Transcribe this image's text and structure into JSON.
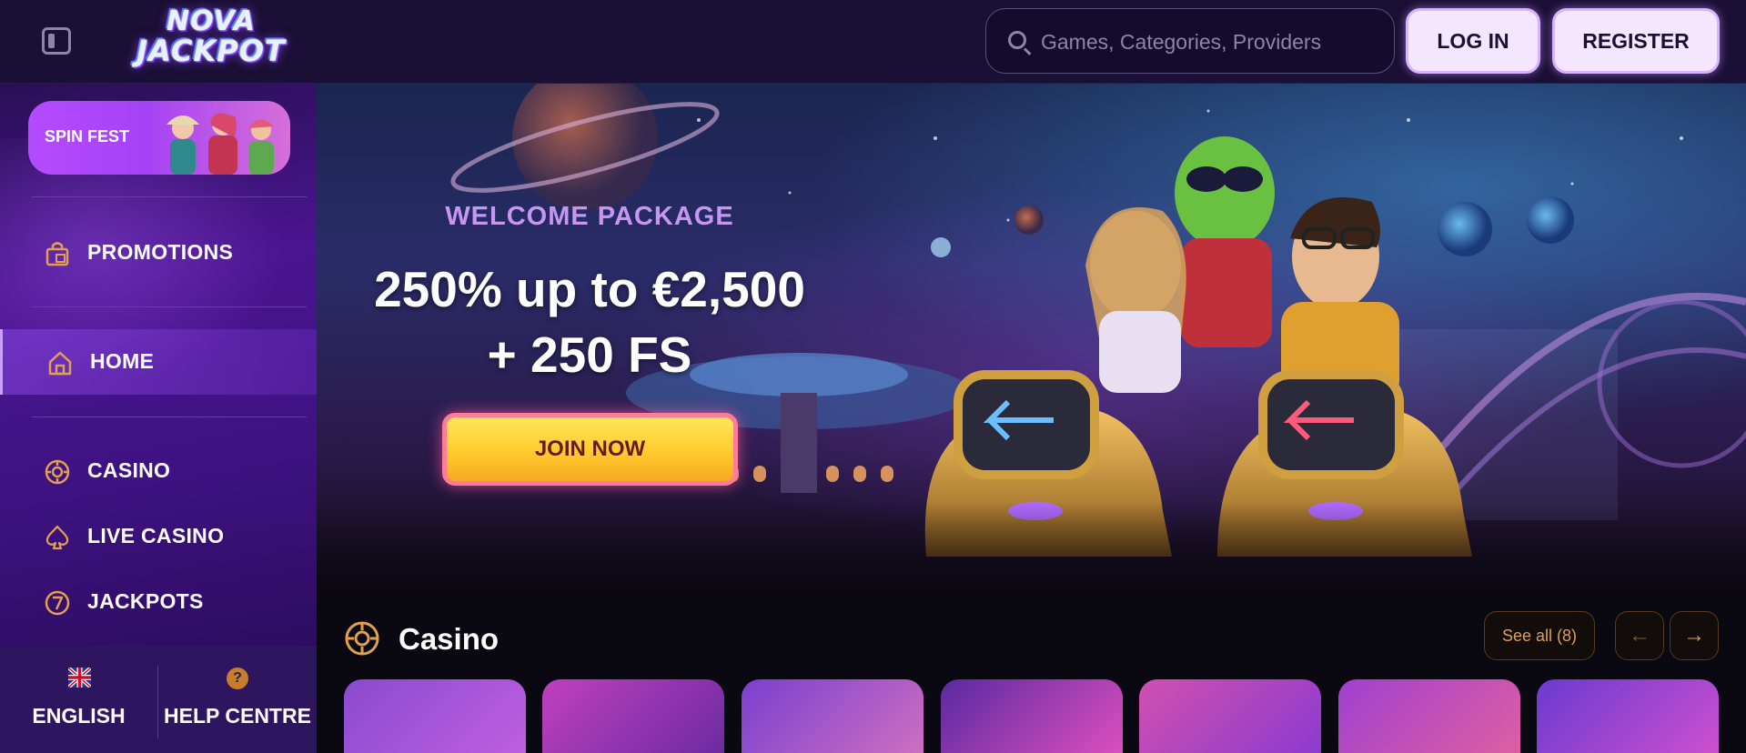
{
  "header": {
    "logo_line1": "NOVA",
    "logo_line2": "JACKPOT",
    "search_placeholder": "Games, Categories, Providers",
    "login_label": "LOG IN",
    "register_label": "REGISTER"
  },
  "sidebar": {
    "promo_banner": {
      "label": "SPIN FEST"
    },
    "items": [
      {
        "label": "PROMOTIONS",
        "icon": "gift-bag-icon",
        "active": false
      },
      {
        "label": "HOME",
        "icon": "home-icon",
        "active": true
      },
      {
        "label": "CASINO",
        "icon": "chip-icon",
        "active": false
      },
      {
        "label": "LIVE CASINO",
        "icon": "spade-icon",
        "active": false
      },
      {
        "label": "JACKPOTS",
        "icon": "seven-icon",
        "active": false
      }
    ],
    "footer": {
      "language_label": "ENGLISH",
      "language_icon": "uk-flag-icon",
      "help_label": "HELP CENTRE",
      "help_icon": "question-icon"
    }
  },
  "hero": {
    "eyebrow": "WELCOME PACKAGE",
    "title_line1": "250% up to €2,500",
    "title_line2": "+ 250 FS",
    "cta_label": "JOIN NOW"
  },
  "casino_section": {
    "title": "Casino",
    "see_all_label": "See all (8)",
    "prev_icon": "arrow-left-icon",
    "next_icon": "arrow-right-icon"
  },
  "colors": {
    "header_bg": "#1a0f35",
    "sidebar_bg": "#4a1590",
    "accent_gold": "#e0a050",
    "cta_yellow": "#ffc82b",
    "cta_border": "#ff7b9a",
    "eyebrow_purple": "#c597f0"
  }
}
